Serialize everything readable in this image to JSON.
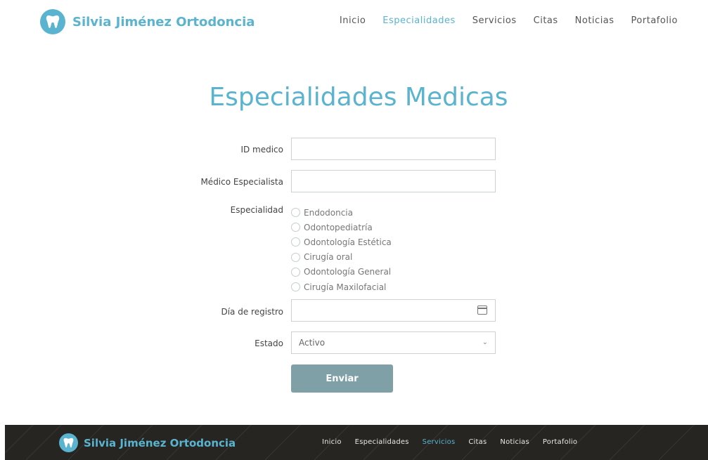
{
  "header": {
    "brand": "Silvia Jiménez Ortodoncia",
    "nav": [
      {
        "label": "Inicio",
        "active": false
      },
      {
        "label": "Especialidades",
        "active": true
      },
      {
        "label": "Servicios",
        "active": false
      },
      {
        "label": "Citas",
        "active": false
      },
      {
        "label": "Noticias",
        "active": false
      },
      {
        "label": "Portafolio",
        "active": false
      }
    ]
  },
  "page": {
    "title": "Especialidades Medicas"
  },
  "form": {
    "id_medico_label": "ID medico",
    "id_medico_value": "",
    "medico_label": "Médico Especialista",
    "medico_value": "",
    "especialidad_label": "Especialidad",
    "especialidades": [
      "Endodoncia",
      "Odontopediatría",
      "Odontología Estética",
      "Cirugía oral",
      "Odontología General",
      "Cirugía Maxilofacial"
    ],
    "dia_label": "Día de registro",
    "dia_value": "",
    "estado_label": "Estado",
    "estado_value": "Activo",
    "submit_label": "Enviar"
  },
  "footer": {
    "brand": "Silvia Jiménez Ortodoncia",
    "nav": [
      {
        "label": "Inicio",
        "active": false
      },
      {
        "label": "Especialidades",
        "active": false
      },
      {
        "label": "Servicios",
        "active": true
      },
      {
        "label": "Citas",
        "active": false
      },
      {
        "label": "Noticias",
        "active": false
      },
      {
        "label": "Portafolio",
        "active": false
      }
    ]
  },
  "colors": {
    "accent": "#5ab3cf",
    "button": "#7fa0a7",
    "footer_bg": "#262521"
  }
}
